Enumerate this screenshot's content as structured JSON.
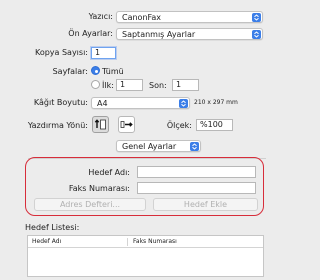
{
  "printer": {
    "label": "Yazıcı:",
    "value": "CanonFax"
  },
  "presets": {
    "label": "Ön Ayarlar:",
    "value": "Saptanmış Ayarlar"
  },
  "copies": {
    "label": "Kopya Sayısı:",
    "value": "1"
  },
  "pages": {
    "label": "Sayfalar:",
    "all_label": "Tümü",
    "from_label": "İlk:",
    "from_value": "1",
    "to_label": "Son:",
    "to_value": "1"
  },
  "paper_size": {
    "label": "Kâğıt Boyutu:",
    "value": "A4",
    "dimensions": "210 x 297 mm"
  },
  "orientation": {
    "label": "Yazdırma Yönü:"
  },
  "scale": {
    "label": "Ölçek:",
    "value": "%100"
  },
  "section_popup": {
    "value": "Genel Ayarlar"
  },
  "destination": {
    "name_label": "Hedef Adı:",
    "name_value": "",
    "fax_label": "Faks Numarası:",
    "fax_value": "",
    "address_book_button": "Adres Defteri...",
    "add_button": "Hedef Ekle"
  },
  "destination_list": {
    "title": "Hedef Listesi:",
    "columns": [
      "Hedef Adı",
      "Faks Numarası"
    ],
    "rows": []
  },
  "colors": {
    "accent": "#3b7ee8",
    "highlight": "#d72d3a"
  }
}
